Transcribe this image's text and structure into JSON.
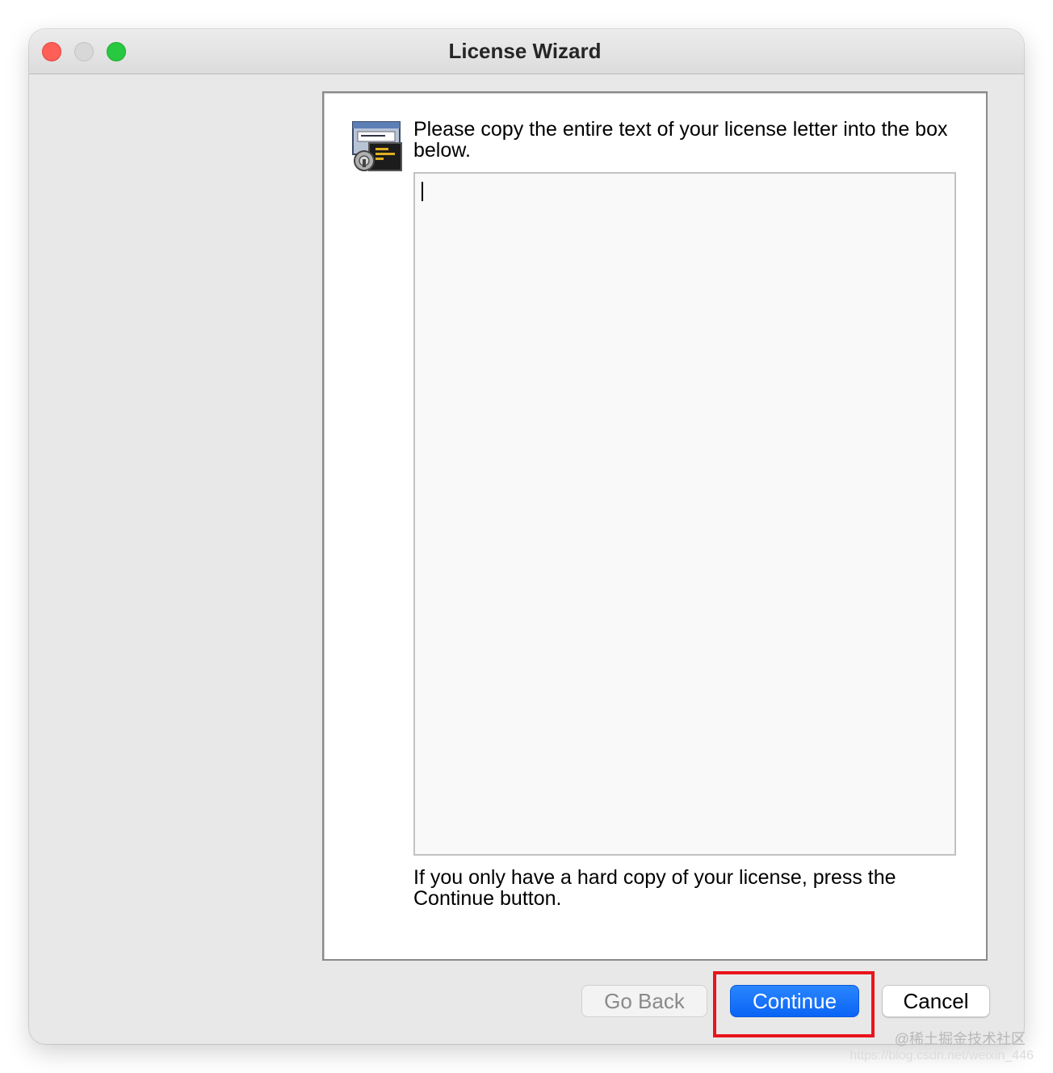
{
  "window": {
    "title": "License Wizard"
  },
  "panel": {
    "icon": "license-certificate-icon",
    "instruction": "Please copy the entire text of your license letter into the box below.",
    "license_text": "",
    "footnote": "If you only have a hard copy of your license, press the Continue button."
  },
  "buttons": {
    "go_back": "Go Back",
    "continue": "Continue",
    "cancel": "Cancel"
  },
  "watermark": {
    "line1": "@稀土掘金技术社区",
    "line2": "https://blog.csdn.net/weixin_446"
  },
  "colors": {
    "accent": "#0a64f5",
    "highlight": "#e8141c"
  }
}
